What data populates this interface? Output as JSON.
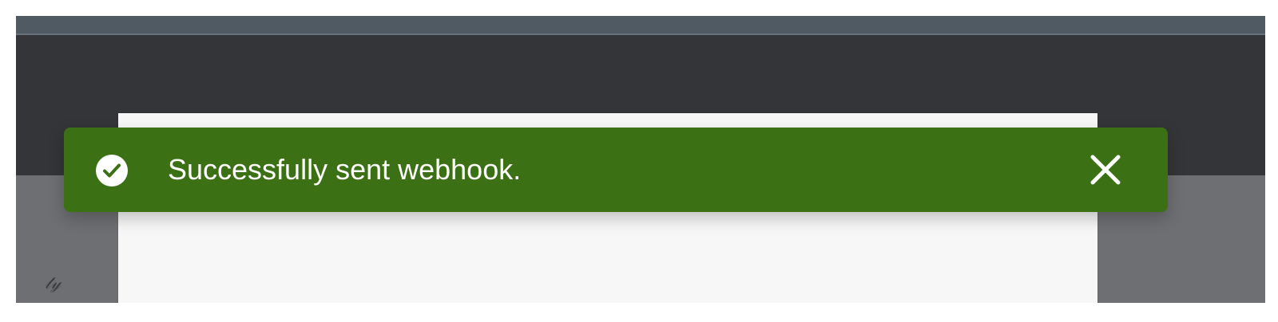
{
  "toast": {
    "message": "Successfully sent webhook.",
    "status": "success",
    "background_color": "#3b7114",
    "icon": "check-circle-icon",
    "close_icon": "close-icon"
  },
  "colors": {
    "top_strip": "#4f5a62",
    "header": "#333538",
    "overlay": "#6e6f72",
    "panel": "#f7f7f7"
  }
}
